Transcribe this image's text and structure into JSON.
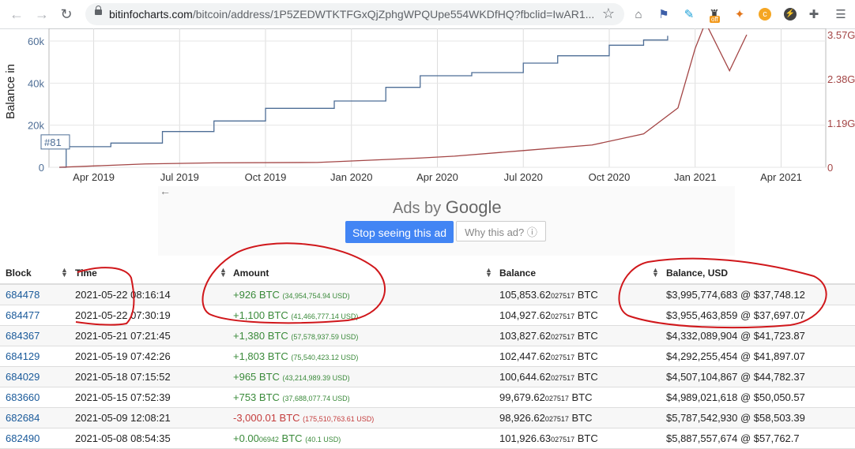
{
  "browser": {
    "back": "←",
    "forward": "→",
    "reload": "↻",
    "url_host": "bitinfocharts.com",
    "url_path": "/bitcoin/address/1P5ZEDWTKTFGxQjZphgWPQUpe554WKDfHQ?fbclid=IwAR1...",
    "ext_badge": "off"
  },
  "chart_data": {
    "type": "line",
    "ylabel": "Balance in",
    "left_ticks": [
      "60k",
      "40k",
      "20k",
      "0"
    ],
    "right_ticks": [
      "3.57G",
      "2.38G",
      "1.19G",
      "0"
    ],
    "x_ticks": [
      "Apr 2019",
      "Jul 2019",
      "Oct 2019",
      "Jan 2020",
      "Apr 2020",
      "Jul 2020",
      "Oct 2020",
      "Jan 2021",
      "Apr 2021"
    ],
    "marker_label": "#81",
    "series": [
      {
        "color": "#4e6e96",
        "x": [
          2019.15,
          2019.17,
          2019.3,
          2019.45,
          2019.6,
          2019.75,
          2019.95,
          2020.1,
          2020.2,
          2020.35,
          2020.5,
          2020.6,
          2020.75,
          2020.85,
          2020.92
        ],
        "y": [
          0,
          9800,
          11500,
          17000,
          22000,
          28000,
          31500,
          38000,
          43500,
          45000,
          49500,
          53000,
          58000,
          60500,
          62500
        ]
      },
      {
        "color": "#a34545",
        "x": [
          2019.15,
          2019.4,
          2019.6,
          2019.9,
          2020.2,
          2020.3,
          2020.5,
          2020.7,
          2020.85,
          2020.95,
          2021.0,
          2021.03,
          2021.1,
          2021.15
        ],
        "y": [
          0,
          0.09,
          0.12,
          0.13,
          0.25,
          0.3,
          0.45,
          0.6,
          0.9,
          1.6,
          3.2,
          3.9,
          2.6,
          3.57
        ]
      }
    ],
    "colors": {
      "balance_line": "#4e6e96",
      "usd_line": "#a34545"
    }
  },
  "ad": {
    "back_arrow": "←",
    "ads_by": "Ads by",
    "google": "Google",
    "stop_label": "Stop seeing this ad",
    "why_label": "Why this ad? ⓘ"
  },
  "table": {
    "headers": [
      "Block",
      "Time",
      "Amount",
      "Balance",
      "Balance, USD"
    ],
    "rows": [
      {
        "block": "684478",
        "time": "2021-05-22 08:16:14",
        "amount": "+926 BTC",
        "amount_usd": "(34,954,754.94 USD)",
        "sign": "pos",
        "bal_main": "105,853.62",
        "bal_small": "027517",
        "bal_unit": " BTC",
        "bal_usd": "$3,995,774,683 @ $37,748.12"
      },
      {
        "block": "684477",
        "time": "2021-05-22 07:30:19",
        "amount": "+1,100 BTC",
        "amount_usd": "(41,466,777.14 USD)",
        "sign": "pos",
        "bal_main": "104,927.62",
        "bal_small": "027517",
        "bal_unit": " BTC",
        "bal_usd": "$3,955,463,859 @ $37,697.07"
      },
      {
        "block": "684367",
        "time": "2021-05-21 07:21:45",
        "amount": "+1,380 BTC",
        "amount_usd": "(57,578,937.59 USD)",
        "sign": "pos",
        "bal_main": "103,827.62",
        "bal_small": "027517",
        "bal_unit": " BTC",
        "bal_usd": "$4,332,089,904 @ $41,723.87"
      },
      {
        "block": "684129",
        "time": "2021-05-19 07:42:26",
        "amount": "+1,803 BTC",
        "amount_usd": "(75,540,423.12 USD)",
        "sign": "pos",
        "bal_main": "102,447.62",
        "bal_small": "027517",
        "bal_unit": " BTC",
        "bal_usd": "$4,292,255,454 @ $41,897.07"
      },
      {
        "block": "684029",
        "time": "2021-05-18 07:15:52",
        "amount": "+965 BTC",
        "amount_usd": "(43,214,989.39 USD)",
        "sign": "pos",
        "bal_main": "100,644.62",
        "bal_small": "027517",
        "bal_unit": " BTC",
        "bal_usd": "$4,507,104,867 @ $44,782.37"
      },
      {
        "block": "683660",
        "time": "2021-05-15 07:52:39",
        "amount": "+753 BTC",
        "amount_usd": "(37,688,077.74 USD)",
        "sign": "pos",
        "bal_main": "99,679.62",
        "bal_small": "027517",
        "bal_unit": " BTC",
        "bal_usd": "$4,989,021,618 @ $50,050.57"
      },
      {
        "block": "682684",
        "time": "2021-05-09 12:08:21",
        "amount": "-3,000.01 BTC",
        "amount_usd": "(175,510,763.61 USD)",
        "sign": "neg",
        "bal_main": "98,926.62",
        "bal_small": "027517",
        "bal_unit": " BTC",
        "bal_usd": "$5,787,542,930 @ $58,503.39"
      },
      {
        "block": "682490",
        "time": "2021-05-08 08:54:35",
        "amount": "+0.00",
        "amount_small": "06942",
        "amount_unit": " BTC",
        "amount_usd": "(40.1 USD)",
        "sign": "pos",
        "bal_main": "101,926.63",
        "bal_small": "027517",
        "bal_unit": " BTC",
        "bal_usd": "$5,887,557,674 @ $57,762.7"
      }
    ]
  }
}
